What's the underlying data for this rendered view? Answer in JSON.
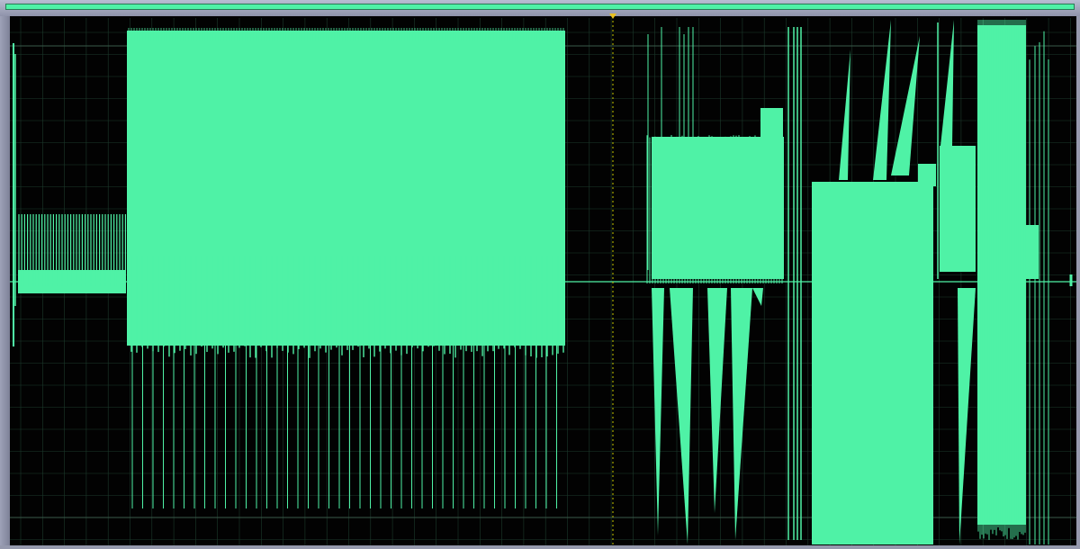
{
  "app": {
    "view": "waveform-editor",
    "colors": {
      "waveform": "#4ff2a6",
      "background": "#020202",
      "grid": "#1c3a2c",
      "chrome": "#9599ad",
      "playhead": "#c8c800",
      "marker": "#e8c020"
    }
  },
  "overview": {
    "icon": "overview-bar"
  },
  "playhead": {
    "icon": "playhead-marker-icon"
  }
}
